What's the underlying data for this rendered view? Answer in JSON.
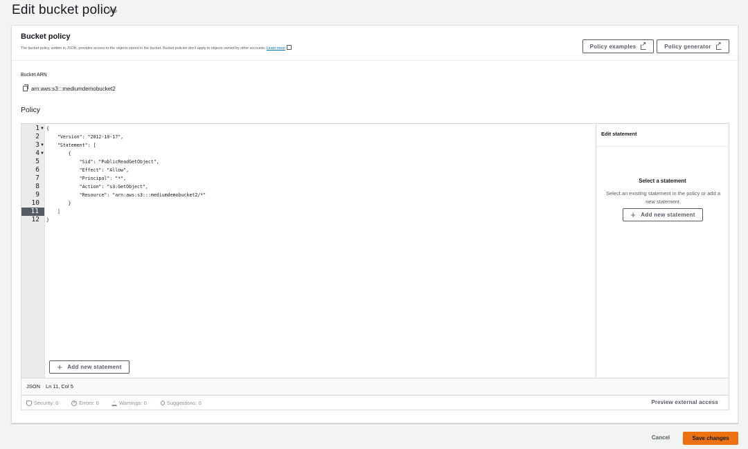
{
  "page": {
    "title": "Edit bucket policy",
    "info_label": "Info"
  },
  "panel": {
    "title": "Bucket policy",
    "description": "The bucket policy, written in JSON, provides access to the objects stored in the bucket. Bucket policies don't apply to objects owned by other accounts.",
    "learn_more": "Learn more",
    "policy_examples_label": "Policy examples",
    "policy_generator_label": "Policy generator"
  },
  "arn": {
    "label": "Bucket ARN",
    "value": "arn:aws:s3:::mediumdemobucket2"
  },
  "policy": {
    "label": "Policy"
  },
  "editor": {
    "lines": [
      {
        "num": "1",
        "text": "{",
        "fold": true
      },
      {
        "num": "2",
        "text": "    \"Version\": \"2012-10-17\",",
        "fold": false
      },
      {
        "num": "3",
        "text": "    \"Statement\": [",
        "fold": true
      },
      {
        "num": "4",
        "text": "        {",
        "fold": true
      },
      {
        "num": "5",
        "text": "            \"Sid\": \"PublicReadGetObject\",",
        "fold": false
      },
      {
        "num": "6",
        "text": "            \"Effect\": \"Allow\",",
        "fold": false
      },
      {
        "num": "7",
        "text": "            \"Principal\": \"*\",",
        "fold": false
      },
      {
        "num": "8",
        "text": "            \"Action\": \"s3:GetObject\",",
        "fold": false
      },
      {
        "num": "9",
        "text": "            \"Resource\": \"arn:aws:s3:::mediumdemobucket2/*\"",
        "fold": false
      },
      {
        "num": "10",
        "text": "        }",
        "fold": false
      },
      {
        "num": "11",
        "text": "    ]",
        "fold": false
      },
      {
        "num": "12",
        "text": "}",
        "fold": false
      }
    ],
    "active_line": "11",
    "add_statement_label": "Add new statement"
  },
  "side_panel": {
    "title": "Edit statement",
    "heading": "Select a statement",
    "text": "Select an existing statement in the policy or add a new statement.",
    "add_statement_label": "Add new statement"
  },
  "status": {
    "language": "JSON",
    "position": "Ln 11, Col 5"
  },
  "validation": {
    "security": "Security: 0",
    "errors": "Errors: 0",
    "warnings": "Warnings: 0",
    "suggestions": "Suggestions: 0",
    "preview_label": "Preview external access"
  },
  "footer": {
    "cancel_label": "Cancel",
    "save_label": "Save changes"
  },
  "colors": {
    "primary": "#ec7211",
    "link": "#0073bb",
    "active_line": "#545b64"
  }
}
